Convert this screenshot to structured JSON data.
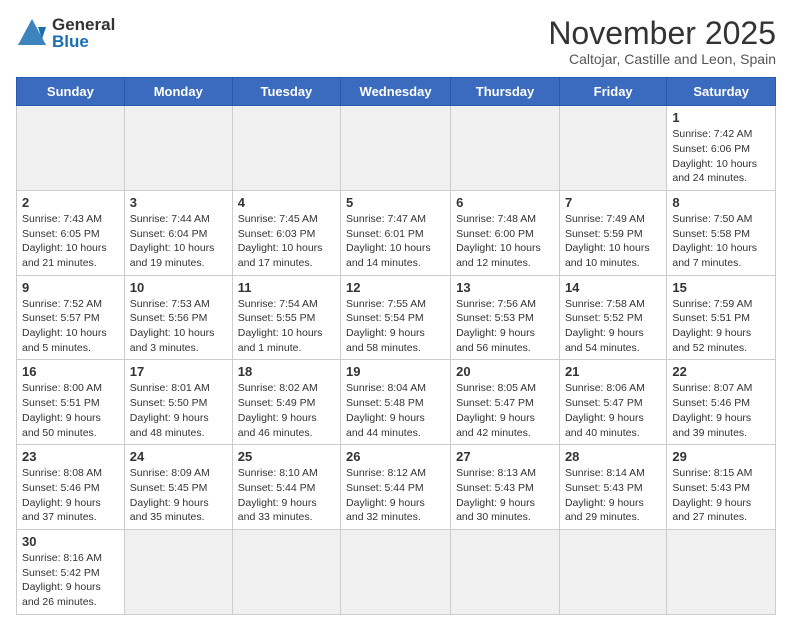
{
  "logo": {
    "line1": "General",
    "line2": "Blue"
  },
  "title": "November 2025",
  "subtitle": "Caltojar, Castille and Leon, Spain",
  "weekdays": [
    "Sunday",
    "Monday",
    "Tuesday",
    "Wednesday",
    "Thursday",
    "Friday",
    "Saturday"
  ],
  "weeks": [
    [
      {
        "day": "",
        "info": "",
        "empty": true
      },
      {
        "day": "",
        "info": "",
        "empty": true
      },
      {
        "day": "",
        "info": "",
        "empty": true
      },
      {
        "day": "",
        "info": "",
        "empty": true
      },
      {
        "day": "",
        "info": "",
        "empty": true
      },
      {
        "day": "",
        "info": "",
        "empty": true
      },
      {
        "day": "1",
        "info": "Sunrise: 7:42 AM\nSunset: 6:06 PM\nDaylight: 10 hours and 24 minutes."
      }
    ],
    [
      {
        "day": "2",
        "info": "Sunrise: 7:43 AM\nSunset: 6:05 PM\nDaylight: 10 hours and 21 minutes."
      },
      {
        "day": "3",
        "info": "Sunrise: 7:44 AM\nSunset: 6:04 PM\nDaylight: 10 hours and 19 minutes."
      },
      {
        "day": "4",
        "info": "Sunrise: 7:45 AM\nSunset: 6:03 PM\nDaylight: 10 hours and 17 minutes."
      },
      {
        "day": "5",
        "info": "Sunrise: 7:47 AM\nSunset: 6:01 PM\nDaylight: 10 hours and 14 minutes."
      },
      {
        "day": "6",
        "info": "Sunrise: 7:48 AM\nSunset: 6:00 PM\nDaylight: 10 hours and 12 minutes."
      },
      {
        "day": "7",
        "info": "Sunrise: 7:49 AM\nSunset: 5:59 PM\nDaylight: 10 hours and 10 minutes."
      },
      {
        "day": "8",
        "info": "Sunrise: 7:50 AM\nSunset: 5:58 PM\nDaylight: 10 hours and 7 minutes."
      }
    ],
    [
      {
        "day": "9",
        "info": "Sunrise: 7:52 AM\nSunset: 5:57 PM\nDaylight: 10 hours and 5 minutes."
      },
      {
        "day": "10",
        "info": "Sunrise: 7:53 AM\nSunset: 5:56 PM\nDaylight: 10 hours and 3 minutes."
      },
      {
        "day": "11",
        "info": "Sunrise: 7:54 AM\nSunset: 5:55 PM\nDaylight: 10 hours and 1 minute."
      },
      {
        "day": "12",
        "info": "Sunrise: 7:55 AM\nSunset: 5:54 PM\nDaylight: 9 hours and 58 minutes."
      },
      {
        "day": "13",
        "info": "Sunrise: 7:56 AM\nSunset: 5:53 PM\nDaylight: 9 hours and 56 minutes."
      },
      {
        "day": "14",
        "info": "Sunrise: 7:58 AM\nSunset: 5:52 PM\nDaylight: 9 hours and 54 minutes."
      },
      {
        "day": "15",
        "info": "Sunrise: 7:59 AM\nSunset: 5:51 PM\nDaylight: 9 hours and 52 minutes."
      }
    ],
    [
      {
        "day": "16",
        "info": "Sunrise: 8:00 AM\nSunset: 5:51 PM\nDaylight: 9 hours and 50 minutes."
      },
      {
        "day": "17",
        "info": "Sunrise: 8:01 AM\nSunset: 5:50 PM\nDaylight: 9 hours and 48 minutes."
      },
      {
        "day": "18",
        "info": "Sunrise: 8:02 AM\nSunset: 5:49 PM\nDaylight: 9 hours and 46 minutes."
      },
      {
        "day": "19",
        "info": "Sunrise: 8:04 AM\nSunset: 5:48 PM\nDaylight: 9 hours and 44 minutes."
      },
      {
        "day": "20",
        "info": "Sunrise: 8:05 AM\nSunset: 5:47 PM\nDaylight: 9 hours and 42 minutes."
      },
      {
        "day": "21",
        "info": "Sunrise: 8:06 AM\nSunset: 5:47 PM\nDaylight: 9 hours and 40 minutes."
      },
      {
        "day": "22",
        "info": "Sunrise: 8:07 AM\nSunset: 5:46 PM\nDaylight: 9 hours and 39 minutes."
      }
    ],
    [
      {
        "day": "23",
        "info": "Sunrise: 8:08 AM\nSunset: 5:46 PM\nDaylight: 9 hours and 37 minutes."
      },
      {
        "day": "24",
        "info": "Sunrise: 8:09 AM\nSunset: 5:45 PM\nDaylight: 9 hours and 35 minutes."
      },
      {
        "day": "25",
        "info": "Sunrise: 8:10 AM\nSunset: 5:44 PM\nDaylight: 9 hours and 33 minutes."
      },
      {
        "day": "26",
        "info": "Sunrise: 8:12 AM\nSunset: 5:44 PM\nDaylight: 9 hours and 32 minutes."
      },
      {
        "day": "27",
        "info": "Sunrise: 8:13 AM\nSunset: 5:43 PM\nDaylight: 9 hours and 30 minutes."
      },
      {
        "day": "28",
        "info": "Sunrise: 8:14 AM\nSunset: 5:43 PM\nDaylight: 9 hours and 29 minutes."
      },
      {
        "day": "29",
        "info": "Sunrise: 8:15 AM\nSunset: 5:43 PM\nDaylight: 9 hours and 27 minutes."
      }
    ],
    [
      {
        "day": "30",
        "info": "Sunrise: 8:16 AM\nSunset: 5:42 PM\nDaylight: 9 hours and 26 minutes."
      },
      {
        "day": "",
        "info": "",
        "empty": true
      },
      {
        "day": "",
        "info": "",
        "empty": true
      },
      {
        "day": "",
        "info": "",
        "empty": true
      },
      {
        "day": "",
        "info": "",
        "empty": true
      },
      {
        "day": "",
        "info": "",
        "empty": true
      },
      {
        "day": "",
        "info": "",
        "empty": true
      }
    ]
  ]
}
